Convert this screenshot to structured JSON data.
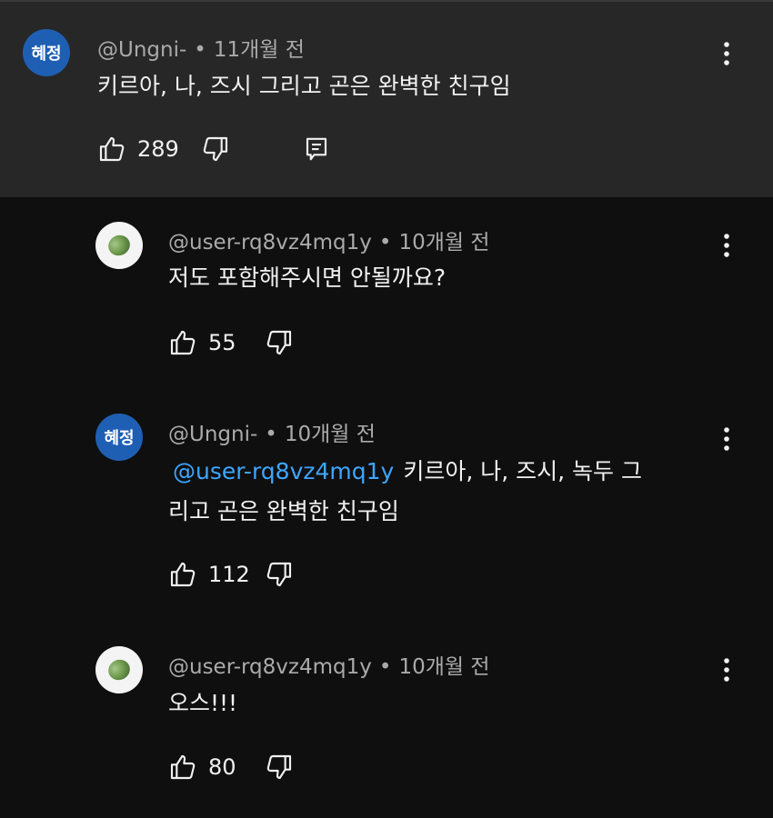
{
  "comments": [
    {
      "avatar_text": "혜정",
      "handle": "@Ungni-",
      "separator": "•",
      "time": "11개월 전",
      "text": "키르아, 나, 즈시 그리고 곤은 완벽한 친구임",
      "likes": "289"
    },
    {
      "handle": "@user-rq8vz4mq1y",
      "separator": "•",
      "time": "10개월 전",
      "text": "저도 포함해주시면 안될까요?",
      "likes": "55"
    },
    {
      "avatar_text": "혜정",
      "handle": "@Ungni-",
      "separator": "•",
      "time": "10개월 전",
      "mention": "@user-rq8vz4mq1y",
      "text_line1": "키르아, 나, 즈시, 녹두 그",
      "text_line2": "리고 곤은 완벽한 친구임",
      "likes": "112"
    },
    {
      "handle": "@user-rq8vz4mq1y",
      "separator": "•",
      "time": "10개월 전",
      "text": "오스!!!",
      "likes": "80"
    }
  ],
  "colors": {
    "background": "#0f0f0f",
    "highlight": "#272727",
    "avatar_blue": "#1f5fb3",
    "mention": "#3ea6ff",
    "meta": "#aaaaaa"
  },
  "icons": [
    "thumb-up-icon",
    "thumb-down-icon",
    "reply-icon",
    "more-vert-icon"
  ]
}
